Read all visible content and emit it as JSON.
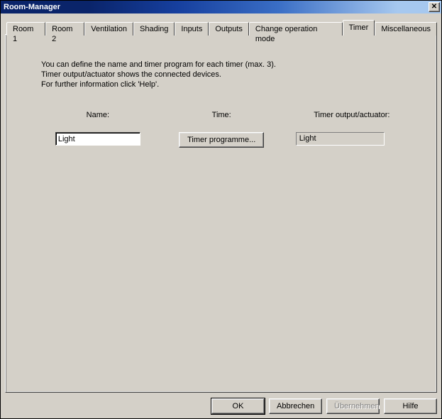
{
  "window": {
    "title": "Room-Manager"
  },
  "tabs": [
    {
      "label": "Room 1"
    },
    {
      "label": "Room 2"
    },
    {
      "label": "Ventilation"
    },
    {
      "label": "Shading"
    },
    {
      "label": "Inputs"
    },
    {
      "label": "Outputs"
    },
    {
      "label": "Change operation mode"
    },
    {
      "label": "Timer"
    },
    {
      "label": "Miscellaneous"
    }
  ],
  "info": {
    "line1": "You can define the name and timer program for each timer (max. 3).",
    "line2": "Timer output/actuator shows the connected devices.",
    "line3": "For further information click 'Help'."
  },
  "headers": {
    "name": "Name:",
    "time": "Time:",
    "output": "Timer output/actuator:"
  },
  "fields": {
    "name_value": "Light",
    "time_button": "Timer programme...",
    "output_value": "Light"
  },
  "buttons": {
    "ok": "OK",
    "cancel": "Abbrechen",
    "apply": "Übernehmen",
    "help": "Hilfe"
  }
}
